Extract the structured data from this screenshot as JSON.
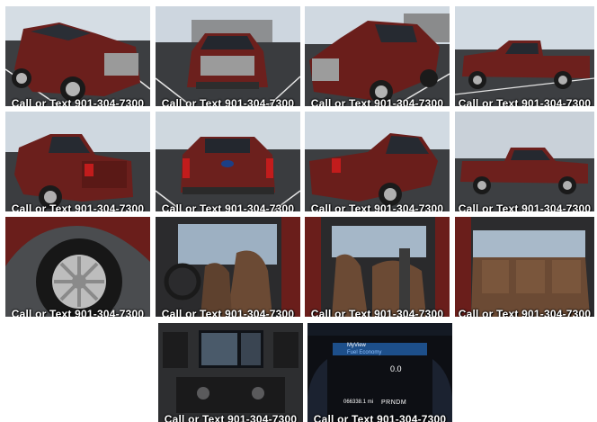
{
  "gallery": {
    "watermark": "Call or Text 901-304-7300",
    "photos": [
      {
        "subject": "front three-quarter view, driver side"
      },
      {
        "subject": "front view"
      },
      {
        "subject": "front three-quarter view, passenger side"
      },
      {
        "subject": "side profile, driver side"
      },
      {
        "subject": "rear three-quarter view, driver side"
      },
      {
        "subject": "rear view with tailgate"
      },
      {
        "subject": "rear three-quarter view, passenger side"
      },
      {
        "subject": "side profile, passenger side"
      },
      {
        "subject": "wheel and tire close-up"
      },
      {
        "subject": "front seats and dashboard"
      },
      {
        "subject": "interior from rear door"
      },
      {
        "subject": "rear bench seats"
      },
      {
        "subject": "center console infotainment screen"
      },
      {
        "subject": "instrument cluster"
      }
    ]
  },
  "cluster": {
    "menu_title": "MyView",
    "menu_item": "Fuel Economy",
    "odometer": "066338.1 mi",
    "gear": "PRNDM",
    "trip": "0.0"
  },
  "colors": {
    "truck_red": "#6e1f1c",
    "sky": "#cfd9e3",
    "asphalt": "#3b3d40",
    "leather": "#6b4a34"
  }
}
